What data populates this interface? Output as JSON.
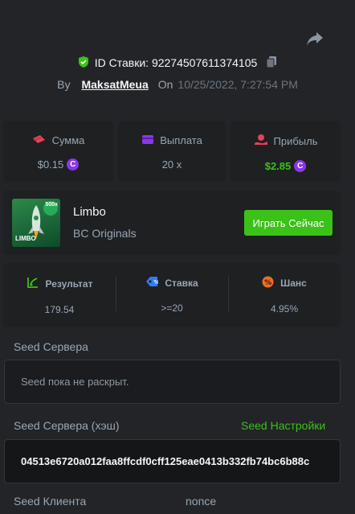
{
  "header": {
    "id_text": "ID Ставки: 92274507611374105",
    "by_label": "By",
    "username": "MaksatMeua",
    "on_label": "On",
    "date": "10/25/2022, 7:27:54 PM"
  },
  "stats": [
    {
      "label": "Сумма",
      "value": "$0.15",
      "icon": "money-icon",
      "coin": true,
      "color": "#98a7b5"
    },
    {
      "label": "Выплата",
      "value": "20 x",
      "icon": "wallet-icon",
      "coin": false,
      "color": "#98a7b5"
    },
    {
      "label": "Прибыль",
      "value": "$2.85",
      "icon": "profit-icon",
      "coin": true,
      "color": "#3bc117"
    }
  ],
  "game": {
    "name": "Limbo",
    "provider": "BC Originals",
    "play_label": "Играть Сейчас",
    "thumb_text": "LIMBO",
    "thumb_badge": "500x"
  },
  "results": [
    {
      "label": "Результат",
      "value": "179.54",
      "icon": "result-icon",
      "icon_color": "#3bc117"
    },
    {
      "label": "Ставка",
      "value": ">=20",
      "icon": "tag-icon",
      "icon_color": "#2f7df6"
    },
    {
      "label": "Шанс",
      "value": "4.95%",
      "icon": "percent-icon",
      "icon_color": "#f26c1e"
    }
  ],
  "seed": {
    "server_label": "Seed Сервера",
    "server_value": "Seed пока не раскрыт.",
    "server_hash_label": "Seed Сервера (хэш)",
    "settings_link": "Seed Настройки",
    "server_hash_value": "04513e6720a012faa8ffcdf0cff125eae0413b332fb74bc6b88c",
    "client_label": "Seed Клиента",
    "nonce_label": "nonce"
  },
  "colors": {
    "accent": "#3bc117",
    "coin": "#8a37e6",
    "background": "#232427",
    "panel": "#1e2022"
  }
}
